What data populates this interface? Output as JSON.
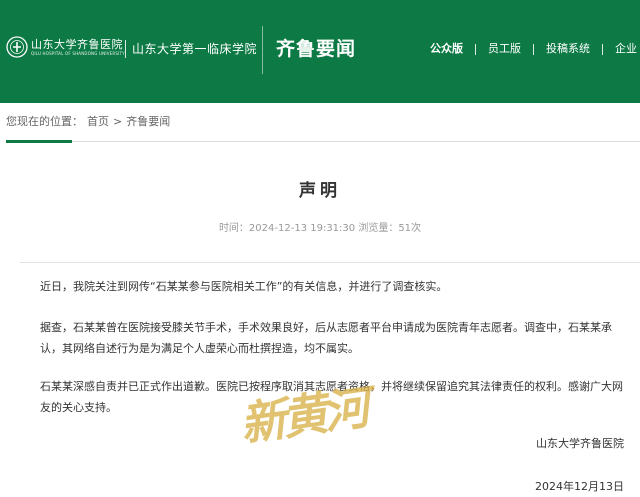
{
  "header": {
    "logo_cn": "山东大学齐鲁医院",
    "logo_en": "QILU HOSPITAL OF SHANDONG UNIVERSITY",
    "second_hospital": "山东大学第一临床学院",
    "channel_title": "齐鲁要闻",
    "brand_color": "#0d7a45",
    "nav": [
      {
        "label": "公众版",
        "active": true
      },
      {
        "label": "员工版",
        "active": false
      },
      {
        "label": "投稿系统",
        "active": false
      },
      {
        "label": "企业",
        "active": false
      }
    ]
  },
  "breadcrumb": {
    "prefix": "您现在的位置：",
    "home": "首页",
    "sep": ">",
    "current": "齐鲁要闻"
  },
  "article": {
    "title": "声明",
    "meta": "时间：2024-12-13 19:31:30 浏览量：51次",
    "paragraphs": [
      "近日，我院关注到网传“石某某参与医院相关工作”的有关信息，并进行了调查核实。",
      "据查，石某某曾在医院接受膝关节手术，手术效果良好，后从志愿者平台申请成为医院青年志愿者。调查中，石某某承认，其网络自述行为是为满足个人虚荣心而杜撰捏造，均不属实。",
      "石某某深感自责并已正式作出道歉。医院已按程序取消其志愿者资格，并将继续保留追究其法律责任的权利。感谢广大网友的关心支持。"
    ],
    "signer": "山东大学齐鲁医院",
    "date": "2024年12月13日"
  },
  "watermark": {
    "text": "新黄河",
    "color": "#d9b24a"
  }
}
